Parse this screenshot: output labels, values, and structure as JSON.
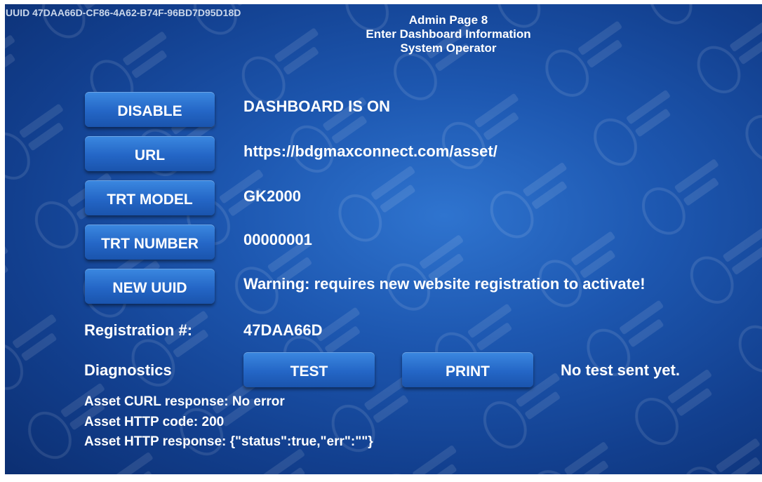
{
  "uuid_line": "UUID 47DAA66D-CF86-4A62-B74F-96BD7D95D18D",
  "header": {
    "line1": "Admin Page 8",
    "line2": "Enter Dashboard Information",
    "line3": "System Operator"
  },
  "rows": {
    "dashboard": {
      "button": "DISABLE",
      "value": "DASHBOARD IS ON"
    },
    "url": {
      "button": "URL",
      "value": "https://bdgmaxconnect.com/asset/"
    },
    "trt_model": {
      "button": "TRT MODEL",
      "value": "GK2000"
    },
    "trt_number": {
      "button": "TRT NUMBER",
      "value": "00000001"
    },
    "new_uuid": {
      "button": "NEW UUID",
      "value": "Warning: requires new website registration to activate!"
    }
  },
  "registration": {
    "label": "Registration #:",
    "value": "47DAA66D"
  },
  "diagnostics": {
    "label": "Diagnostics",
    "test_button": "TEST",
    "print_button": "PRINT",
    "status": "No test sent yet."
  },
  "asset": {
    "curl": "Asset CURL response: No error",
    "http_code": "Asset HTTP code: 200",
    "http_response": "Asset HTTP response: {\"status\":true,\"err\":\"\"}"
  },
  "colors": {
    "background_center": "#2f74cf",
    "background_edge": "#0c2f72",
    "button": "#2466c6",
    "text": "#ffffff"
  }
}
